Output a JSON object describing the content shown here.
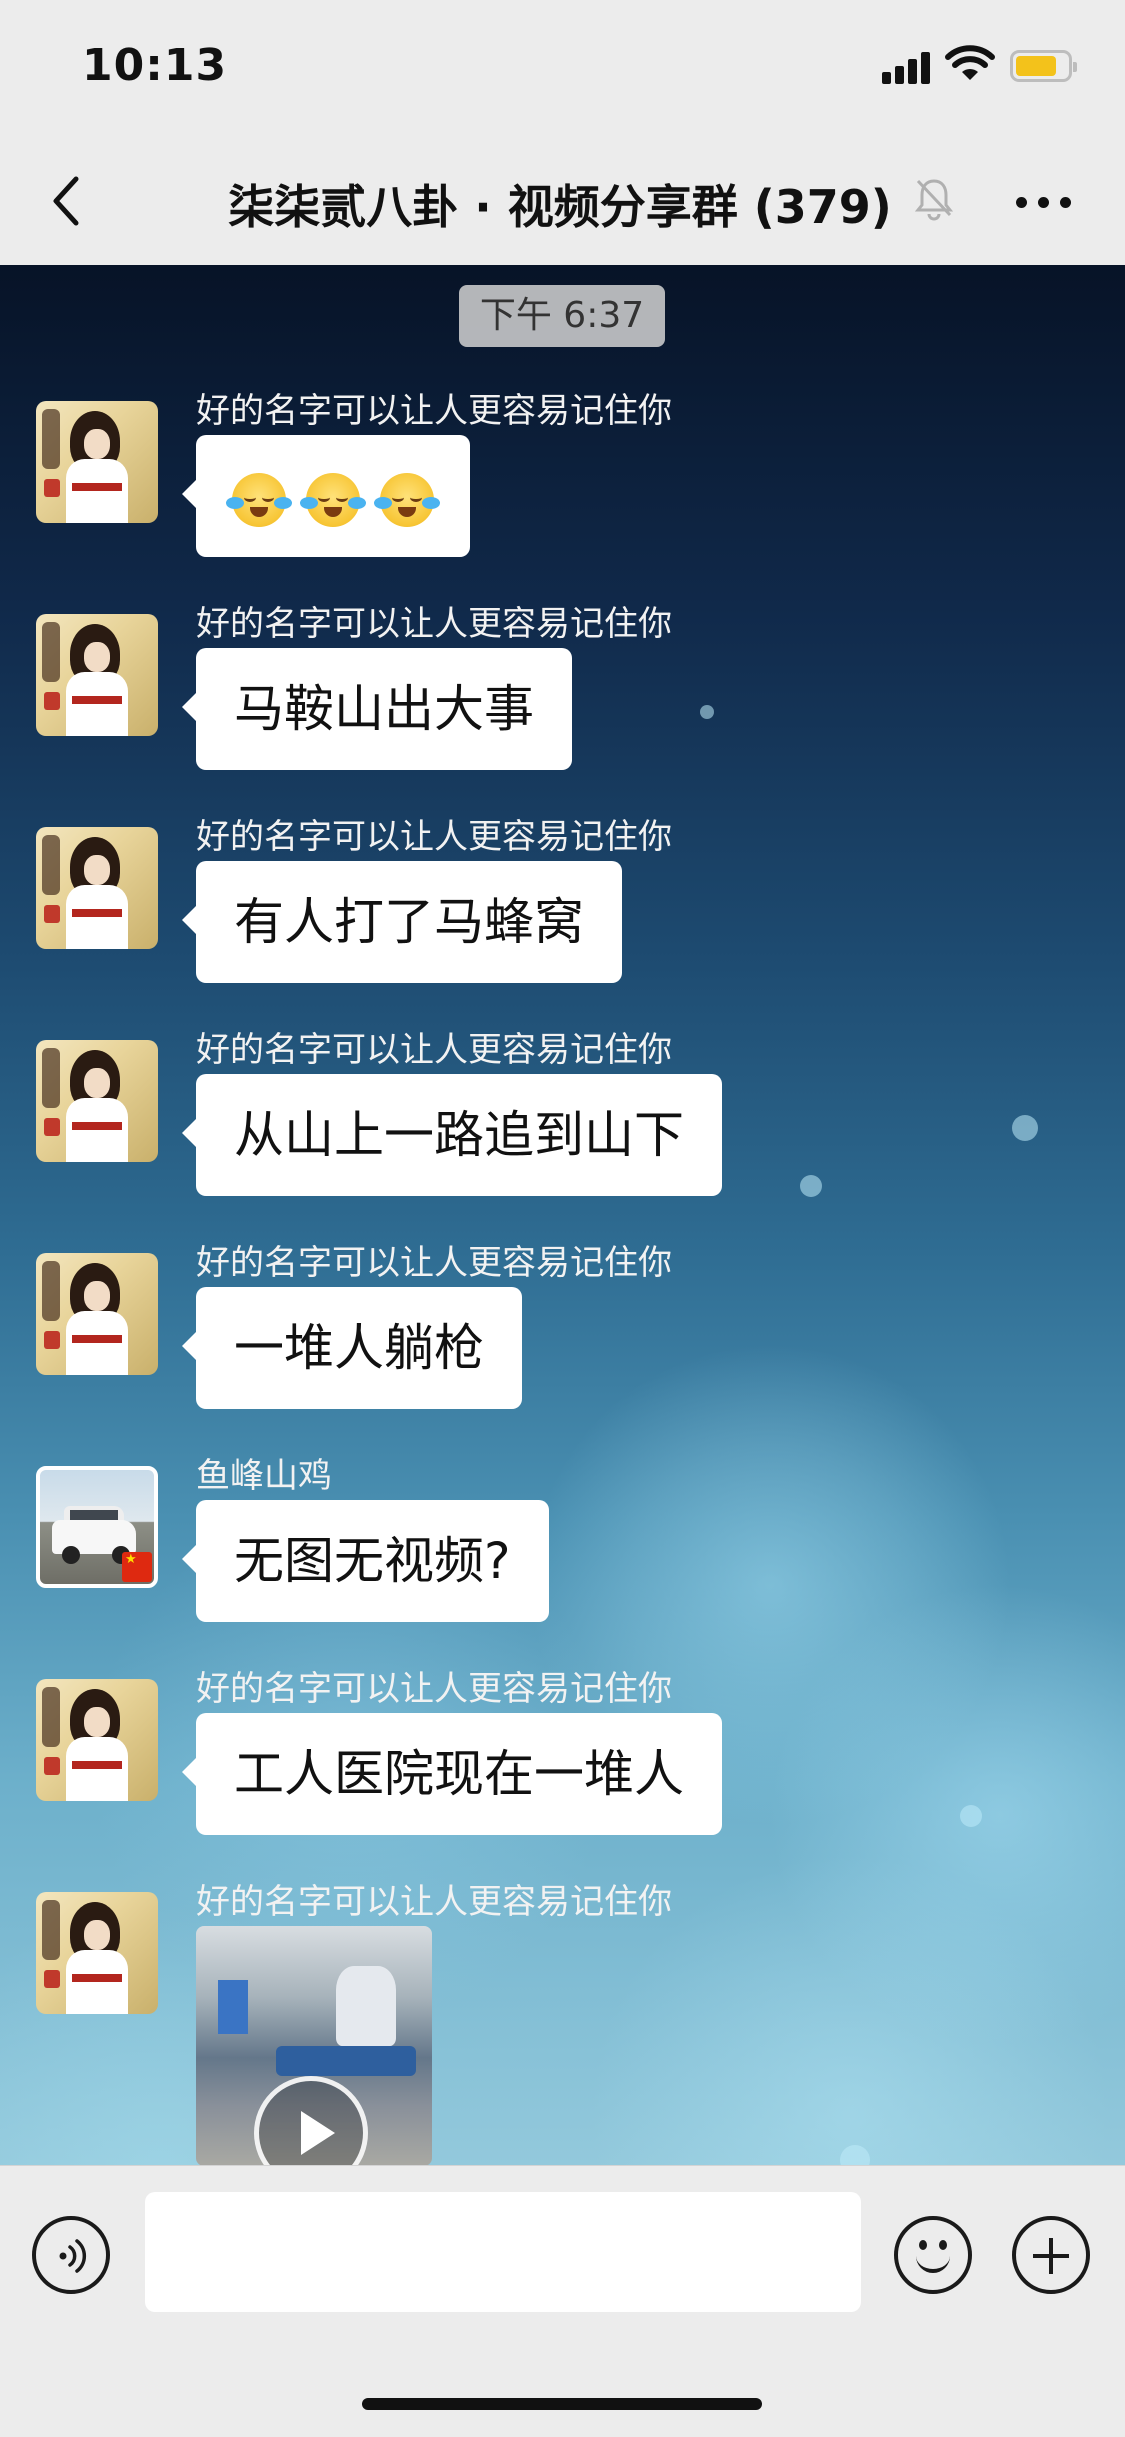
{
  "status_bar": {
    "time": "10:13"
  },
  "header": {
    "title": "柒柒贰八卦 · 视频分享群 (379)"
  },
  "chat": {
    "timestamp": "下午 6:37",
    "messages": [
      {
        "sender": "好的名字可以让人更容易记住你",
        "text": "",
        "emoji": [
          "face-with-tears-of-joy",
          "face-with-tears-of-joy",
          "face-with-tears-of-joy"
        ]
      },
      {
        "sender": "好的名字可以让人更容易记住你",
        "text": "马鞍山出大事"
      },
      {
        "sender": "好的名字可以让人更容易记住你",
        "text": "有人打了马蜂窝"
      },
      {
        "sender": "好的名字可以让人更容易记住你",
        "text": "从山上一路追到山下"
      },
      {
        "sender": "好的名字可以让人更容易记住你",
        "text": "一堆人躺枪"
      },
      {
        "sender": "鱼峰山鸡",
        "text": "无图无视频?"
      },
      {
        "sender": "好的名字可以让人更容易记住你",
        "text": "工人医院现在一堆人"
      },
      {
        "sender": "好的名字可以让人更容易记住你",
        "text": "",
        "attachment": "video-thumbnail"
      }
    ]
  },
  "input_bar": {
    "value": "",
    "icons": [
      "voice-icon",
      "emoji-icon",
      "plus-icon"
    ]
  },
  "colors": {
    "bubble": "#ffffff",
    "bar": "#ececec",
    "battery": "#f3c21b"
  }
}
